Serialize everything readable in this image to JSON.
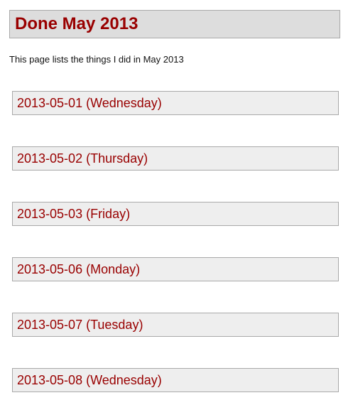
{
  "page": {
    "title": "Done May 2013",
    "intro": "This page lists the things I did in May 2013"
  },
  "days": [
    {
      "heading": "2013-05-01 (Wednesday)"
    },
    {
      "heading": "2013-05-02 (Thursday)"
    },
    {
      "heading": "2013-05-03 (Friday)"
    },
    {
      "heading": "2013-05-06 (Monday)"
    },
    {
      "heading": "2013-05-07 (Tuesday)"
    },
    {
      "heading": "2013-05-08 (Wednesday)"
    }
  ],
  "colors": {
    "title_text": "#990000",
    "header_background": "#dddddd",
    "section_background": "#eeeeee",
    "border": "#a9a9a9"
  }
}
